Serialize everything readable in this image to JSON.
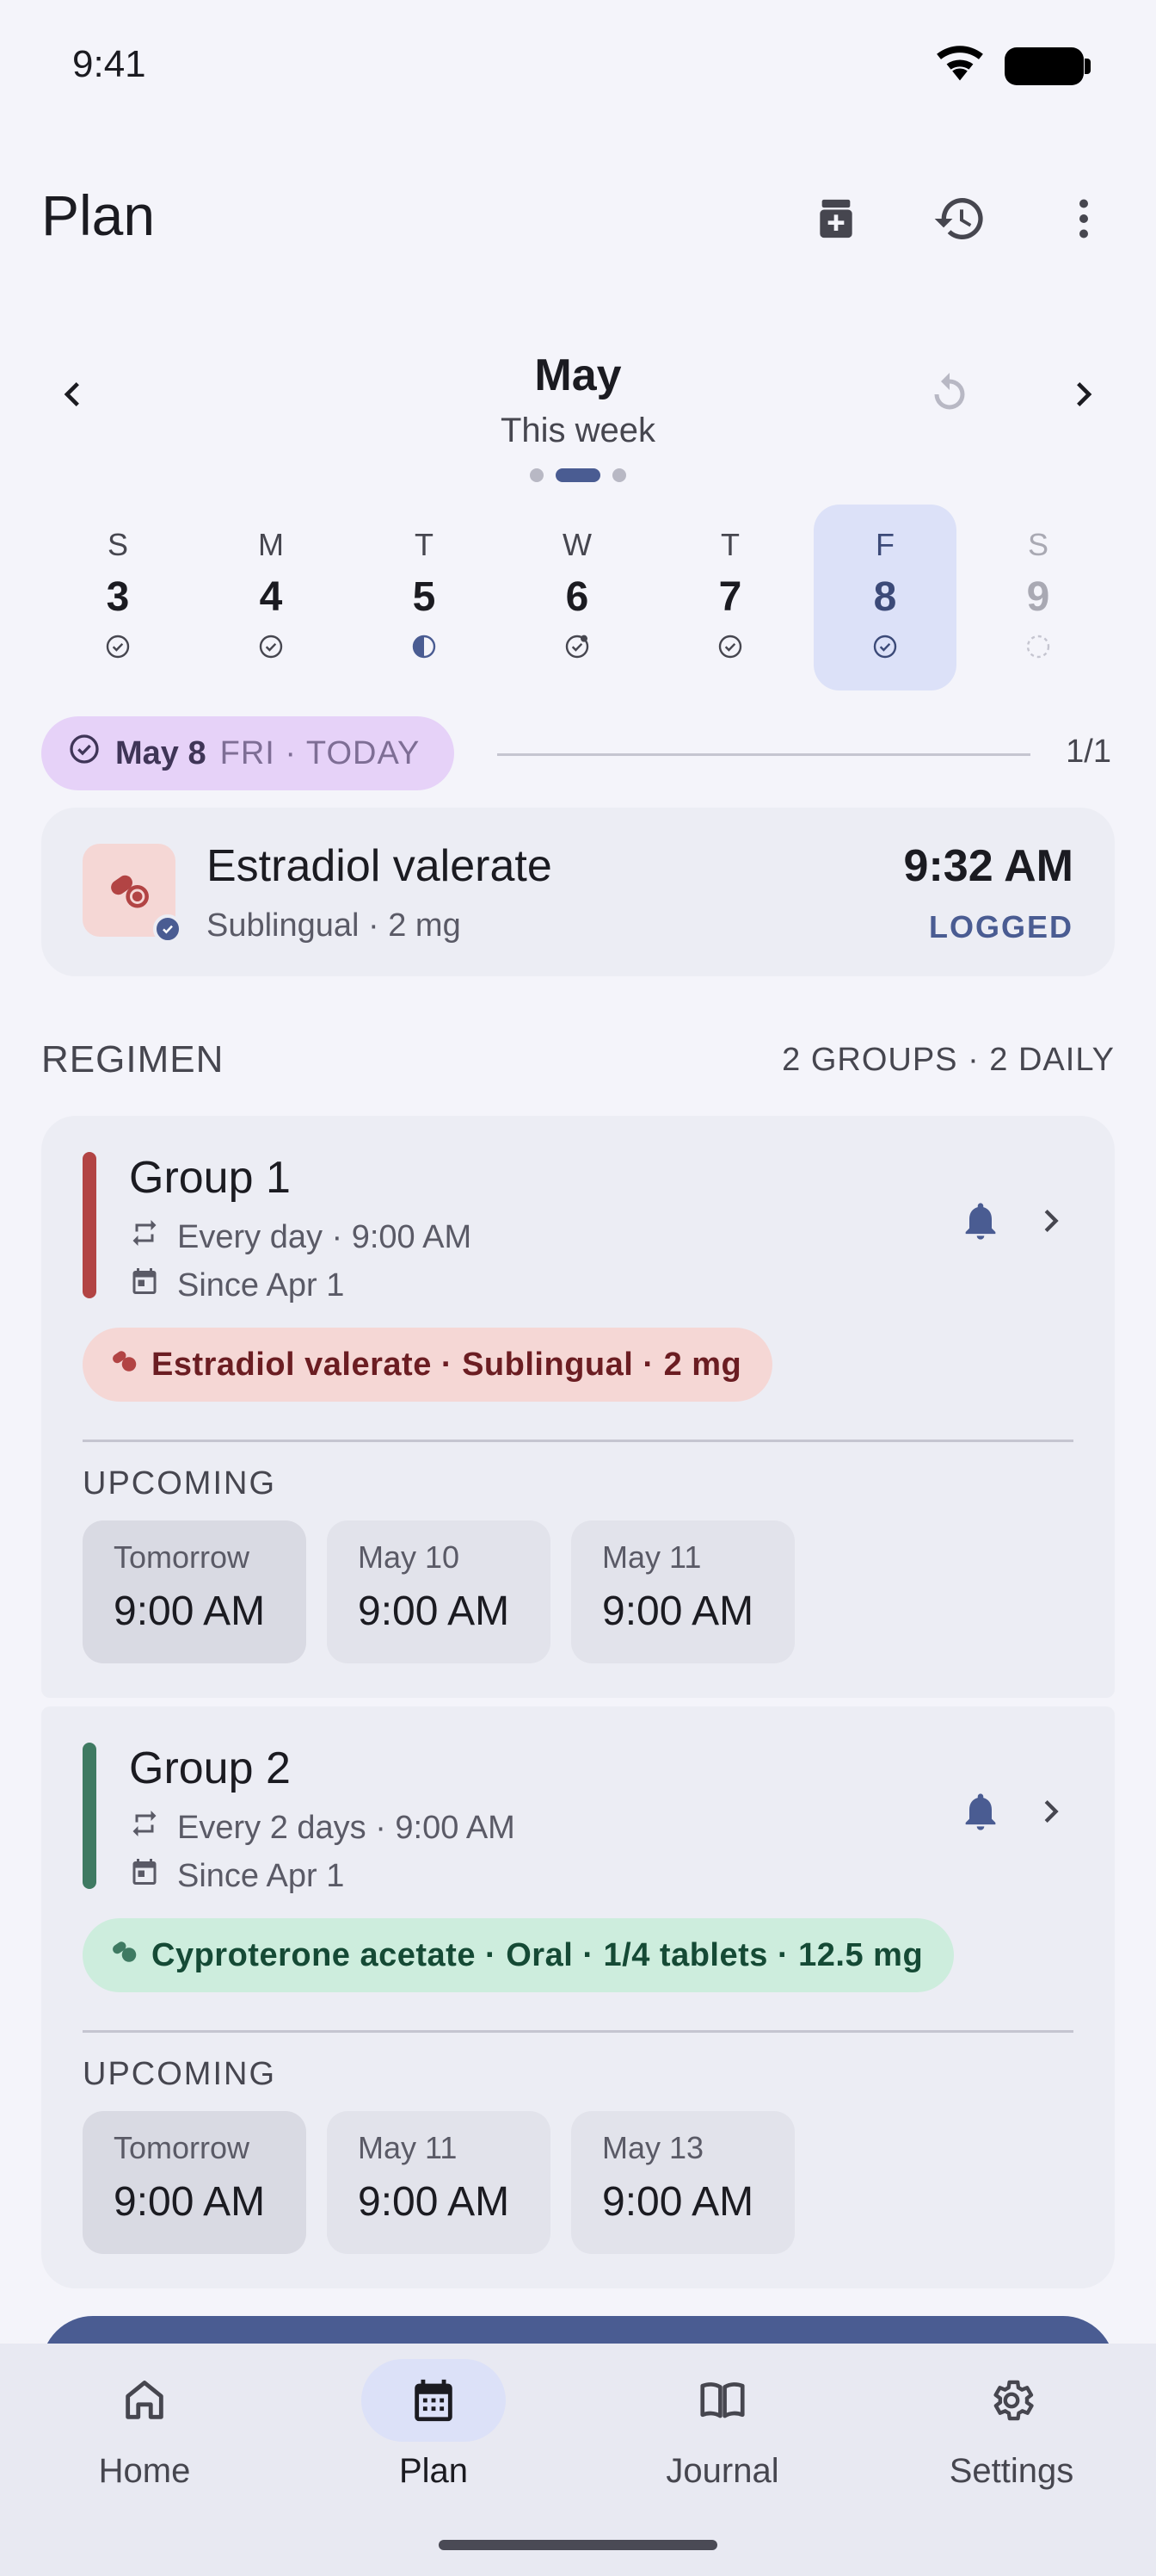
{
  "status_bar": {
    "time": "9:41",
    "icons": [
      "wifi-icon",
      "battery-icon"
    ]
  },
  "app_bar": {
    "title": "Plan",
    "actions": [
      "medication-add-icon",
      "history-icon",
      "more-vert-icon"
    ]
  },
  "week": {
    "month": "May",
    "subtitle": "This week",
    "pager_dots": 3,
    "active_dot": 1,
    "days": [
      {
        "letter": "S",
        "num": "3",
        "status": "done"
      },
      {
        "letter": "M",
        "num": "4",
        "status": "done"
      },
      {
        "letter": "T",
        "num": "5",
        "status": "partial"
      },
      {
        "letter": "W",
        "num": "6",
        "status": "done-note"
      },
      {
        "letter": "T",
        "num": "7",
        "status": "done"
      },
      {
        "letter": "F",
        "num": "8",
        "status": "done",
        "selected": true
      },
      {
        "letter": "S",
        "num": "9",
        "status": "pending",
        "future": true
      }
    ]
  },
  "today": {
    "date": "May 8",
    "rest": "FRI · TODAY",
    "count": "1/1"
  },
  "logged": {
    "name": "Estradiol valerate",
    "detail": "Sublingual · 2 mg",
    "time": "9:32 AM",
    "status": "LOGGED"
  },
  "regimen": {
    "title": "REGIMEN",
    "meta": "2 GROUPS · 2 DAILY",
    "groups": [
      {
        "title": "Group 1",
        "schedule": "Every day · 9:00 AM",
        "since": "Since Apr 1",
        "color": "#B24444",
        "med": "Estradiol valerate · Sublingual · 2 mg",
        "chip_bg": "#F5D7D5",
        "chip_fg": "#6B1D22",
        "upcoming_label": "UPCOMING",
        "upcoming": [
          {
            "date": "Tomorrow",
            "time": "9:00 AM"
          },
          {
            "date": "May 10",
            "time": "9:00 AM"
          },
          {
            "date": "May 11",
            "time": "9:00 AM"
          }
        ]
      },
      {
        "title": "Group 2",
        "schedule": "Every 2 days · 9:00 AM",
        "since": "Since Apr 1",
        "color": "#3F7A62",
        "med": "Cyproterone acetate · Oral · 1/4 tablets · 12.5 mg",
        "chip_bg": "#CDEDDD",
        "chip_fg": "#154A35",
        "upcoming_label": "UPCOMING",
        "upcoming": [
          {
            "date": "Tomorrow",
            "time": "9:00 AM"
          },
          {
            "date": "May 11",
            "time": "9:00 AM"
          },
          {
            "date": "May 13",
            "time": "9:00 AM"
          }
        ]
      }
    ]
  },
  "nav": {
    "items": [
      {
        "label": "Home",
        "icon": "home-icon"
      },
      {
        "label": "Plan",
        "icon": "calendar-icon",
        "active": true
      },
      {
        "label": "Journal",
        "icon": "book-icon"
      },
      {
        "label": "Settings",
        "icon": "gear-icon"
      }
    ]
  },
  "colors": {
    "accent": "#4A5C92",
    "background": "#F4F4FA",
    "surface": "#ECEDF4"
  }
}
